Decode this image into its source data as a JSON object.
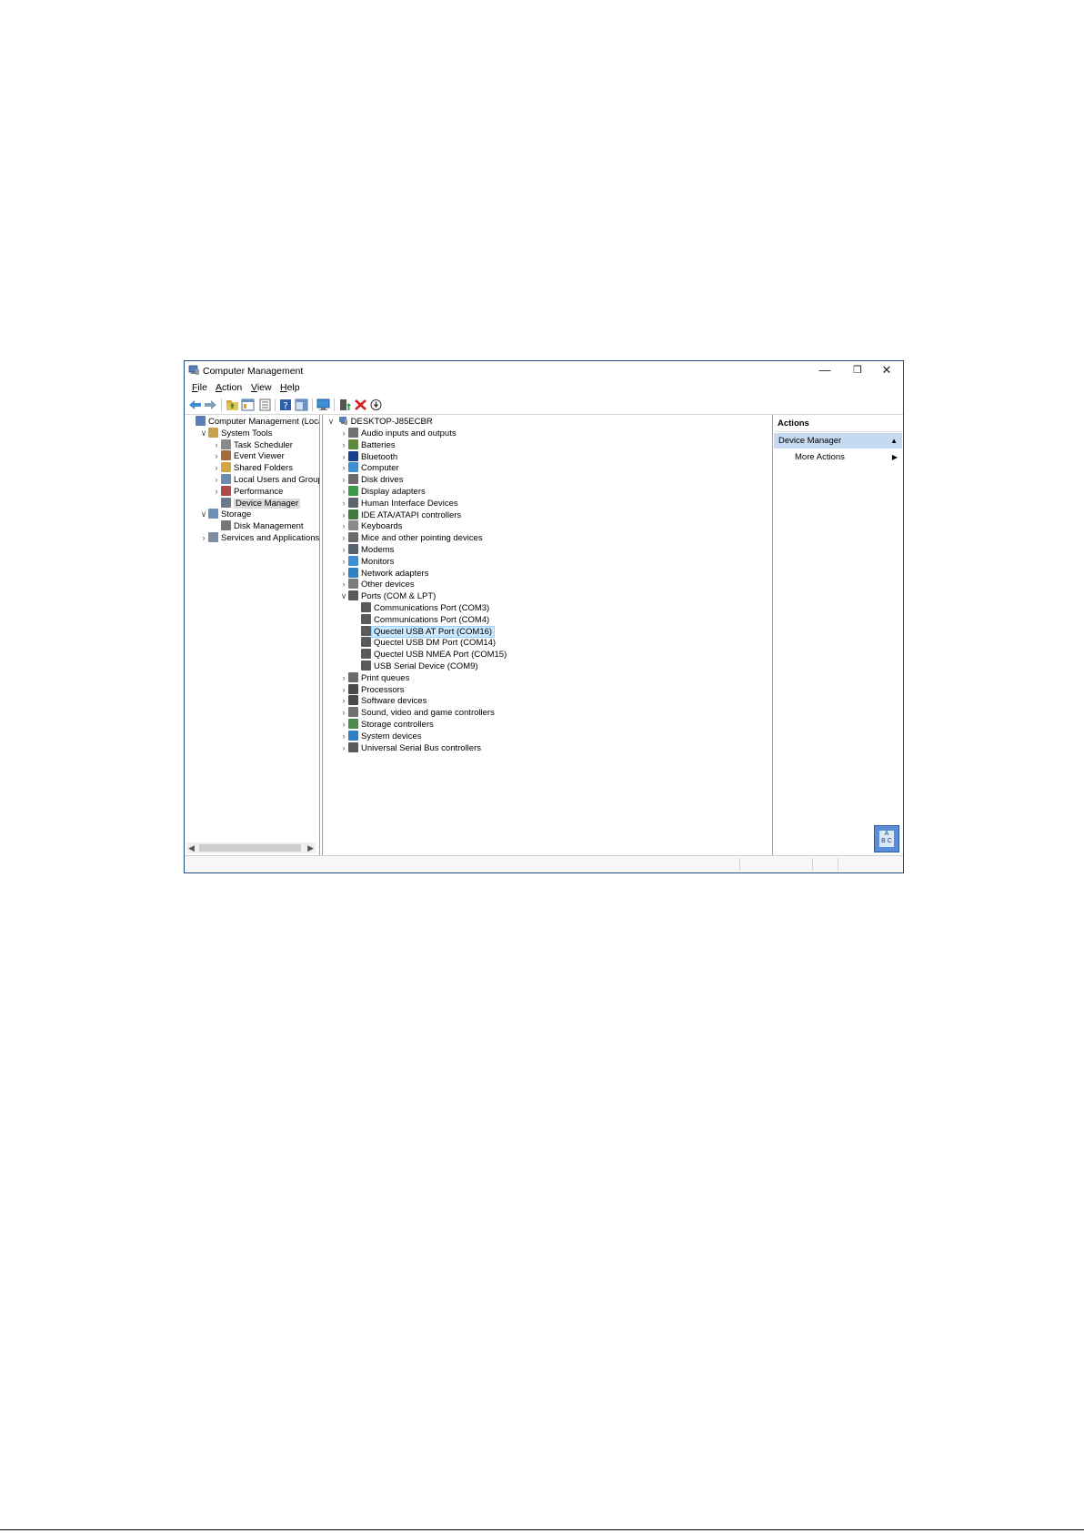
{
  "window": {
    "title": "Computer Management",
    "controls": {
      "minimize": "—",
      "restore": "❐",
      "close": "✕"
    }
  },
  "menu": [
    {
      "key": "F",
      "rest": "ile"
    },
    {
      "key": "A",
      "rest": "ction"
    },
    {
      "key": "V",
      "rest": "iew"
    },
    {
      "key": "H",
      "rest": "elp"
    }
  ],
  "left_tree": [
    {
      "label": "Computer Management (Local",
      "expander": "",
      "indent": 0,
      "icon_color": "#5a7fb8"
    },
    {
      "label": "System Tools",
      "expander": "v",
      "indent": 1,
      "icon_color": "#c8a24a"
    },
    {
      "label": "Task Scheduler",
      "expander": ">",
      "indent": 2,
      "icon_color": "#8a8a8a"
    },
    {
      "label": "Event Viewer",
      "expander": ">",
      "indent": 2,
      "icon_color": "#a56b3a"
    },
    {
      "label": "Shared Folders",
      "expander": ">",
      "indent": 2,
      "icon_color": "#d4a640"
    },
    {
      "label": "Local Users and Groups",
      "expander": ">",
      "indent": 2,
      "icon_color": "#6a8caf"
    },
    {
      "label": "Performance",
      "expander": ">",
      "indent": 2,
      "icon_color": "#b04b4b"
    },
    {
      "label": "Device Manager",
      "expander": "",
      "indent": 2,
      "icon_color": "#6c7a8c",
      "selected": true
    },
    {
      "label": "Storage",
      "expander": "v",
      "indent": 1,
      "icon_color": "#6c8fb6"
    },
    {
      "label": "Disk Management",
      "expander": "",
      "indent": 2,
      "icon_color": "#777777"
    },
    {
      "label": "Services and Applications",
      "expander": ">",
      "indent": 1,
      "icon_color": "#7d8ea3"
    }
  ],
  "device_tree": {
    "root": "DESKTOP-J85ECBR",
    "items": [
      {
        "label": "Audio inputs and outputs",
        "expander": ">",
        "indent": 1,
        "icon_color": "#707070"
      },
      {
        "label": "Batteries",
        "expander": ">",
        "indent": 1,
        "icon_color": "#5d8a3c"
      },
      {
        "label": "Bluetooth",
        "expander": ">",
        "indent": 1,
        "icon_color": "#1b3f8f"
      },
      {
        "label": "Computer",
        "expander": ">",
        "indent": 1,
        "icon_color": "#3b8fd6"
      },
      {
        "label": "Disk drives",
        "expander": ">",
        "indent": 1,
        "icon_color": "#6b6b6b"
      },
      {
        "label": "Display adapters",
        "expander": ">",
        "indent": 1,
        "icon_color": "#3a9a4a"
      },
      {
        "label": "Human Interface Devices",
        "expander": ">",
        "indent": 1,
        "icon_color": "#5c6470"
      },
      {
        "label": "IDE ATA/ATAPI controllers",
        "expander": ">",
        "indent": 1,
        "icon_color": "#3f7a3a"
      },
      {
        "label": "Keyboards",
        "expander": ">",
        "indent": 1,
        "icon_color": "#8a8a8a"
      },
      {
        "label": "Mice and other pointing devices",
        "expander": ">",
        "indent": 1,
        "icon_color": "#6a6a6a"
      },
      {
        "label": "Modems",
        "expander": ">",
        "indent": 1,
        "icon_color": "#556070"
      },
      {
        "label": "Monitors",
        "expander": ">",
        "indent": 1,
        "icon_color": "#3b8fd6"
      },
      {
        "label": "Network adapters",
        "expander": ">",
        "indent": 1,
        "icon_color": "#2f7fc4"
      },
      {
        "label": "Other devices",
        "expander": ">",
        "indent": 1,
        "icon_color": "#7b7b7b"
      },
      {
        "label": "Ports (COM & LPT)",
        "expander": "v",
        "indent": 1,
        "icon_color": "#5a5a5a"
      },
      {
        "label": "Communications Port (COM3)",
        "expander": "",
        "indent": 2,
        "icon_color": "#5a5a5a"
      },
      {
        "label": "Communications Port (COM4)",
        "expander": "",
        "indent": 2,
        "icon_color": "#5a5a5a"
      },
      {
        "label": "Quectel USB AT Port (COM16)",
        "expander": "",
        "indent": 2,
        "icon_color": "#5a5a5a",
        "selected": true
      },
      {
        "label": "Quectel USB DM Port (COM14)",
        "expander": "",
        "indent": 2,
        "icon_color": "#5a5a5a"
      },
      {
        "label": "Quectel USB NMEA Port (COM15)",
        "expander": "",
        "indent": 2,
        "icon_color": "#5a5a5a"
      },
      {
        "label": "USB Serial Device (COM9)",
        "expander": "",
        "indent": 2,
        "icon_color": "#5a5a5a"
      },
      {
        "label": "Print queues",
        "expander": ">",
        "indent": 1,
        "icon_color": "#6b6b6b"
      },
      {
        "label": "Processors",
        "expander": ">",
        "indent": 1,
        "icon_color": "#4a4a4a"
      },
      {
        "label": "Software devices",
        "expander": ">",
        "indent": 1,
        "icon_color": "#4a4a4a"
      },
      {
        "label": "Sound, video and game controllers",
        "expander": ">",
        "indent": 1,
        "icon_color": "#707070"
      },
      {
        "label": "Storage controllers",
        "expander": ">",
        "indent": 1,
        "icon_color": "#4a8a4a"
      },
      {
        "label": "System devices",
        "expander": ">",
        "indent": 1,
        "icon_color": "#2f7fc4"
      },
      {
        "label": "Universal Serial Bus controllers",
        "expander": ">",
        "indent": 1,
        "icon_color": "#5a5a5a"
      }
    ]
  },
  "actions": {
    "header": "Actions",
    "section": "Device Manager",
    "more": "More Actions"
  },
  "toolbar_icons": [
    "back-arrow",
    "forward-arrow",
    "up-folder",
    "show-hide-console-tree",
    "properties",
    "help",
    "show-hide-action-pane",
    "scan-hardware",
    "update-driver",
    "uninstall-device",
    "enable-device"
  ],
  "colors": {
    "window_border": "#1e4f8c",
    "selection_blue": "#cce8ff",
    "actions_section_bg": "#c5d9f1"
  }
}
